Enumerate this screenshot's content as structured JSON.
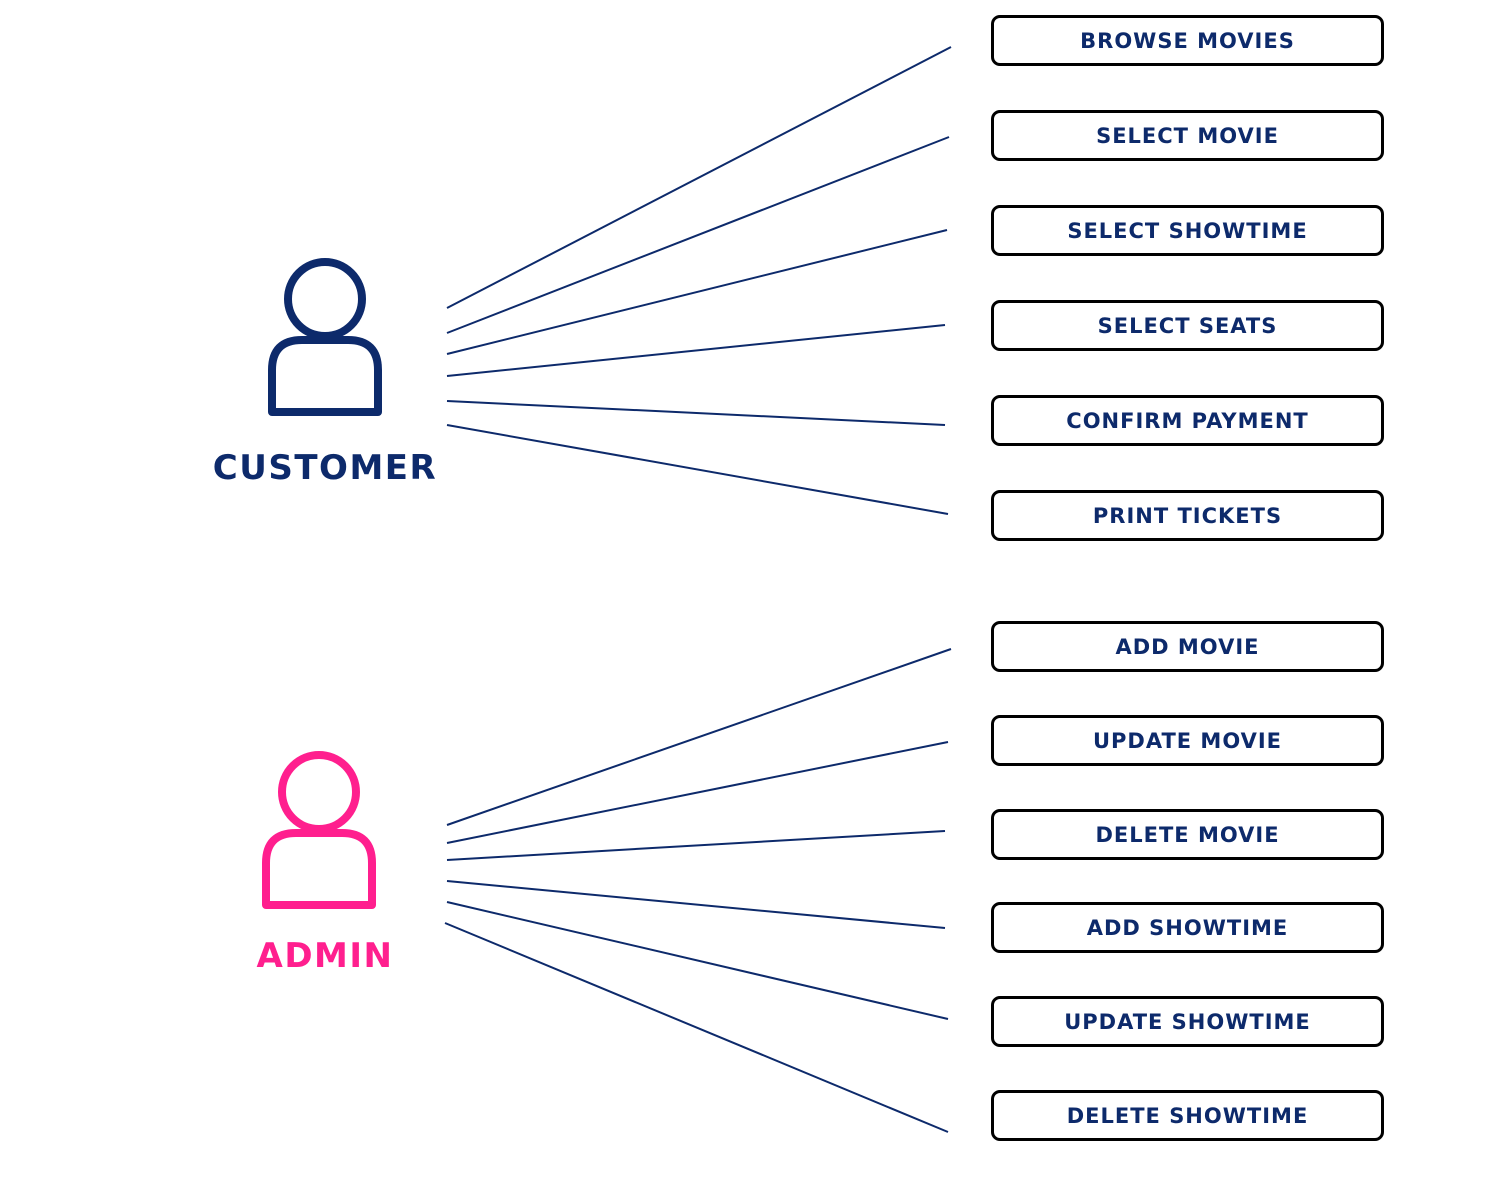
{
  "colors": {
    "customer": "#0d2a6b",
    "admin": "#ff1f8e",
    "connector": "#0d2a6b",
    "box_border": "#000000",
    "box_text": "#0d2a6b"
  },
  "actors": [
    {
      "id": "customer",
      "label": "CUSTOMER",
      "icon": "user-icon",
      "use_cases": [
        "BROWSE MOVIES",
        "SELECT MOVIE",
        "SELECT SHOWTIME",
        "SELECT SEATS",
        "CONFIRM PAYMENT",
        "PRINT TICKETS"
      ]
    },
    {
      "id": "admin",
      "label": "ADMIN",
      "icon": "user-icon",
      "use_cases": [
        "ADD MOVIE",
        "UPDATE MOVIE",
        "DELETE MOVIE",
        "ADD SHOWTIME",
        "UPDATE SHOWTIME",
        "DELETE SHOWTIME"
      ]
    }
  ]
}
